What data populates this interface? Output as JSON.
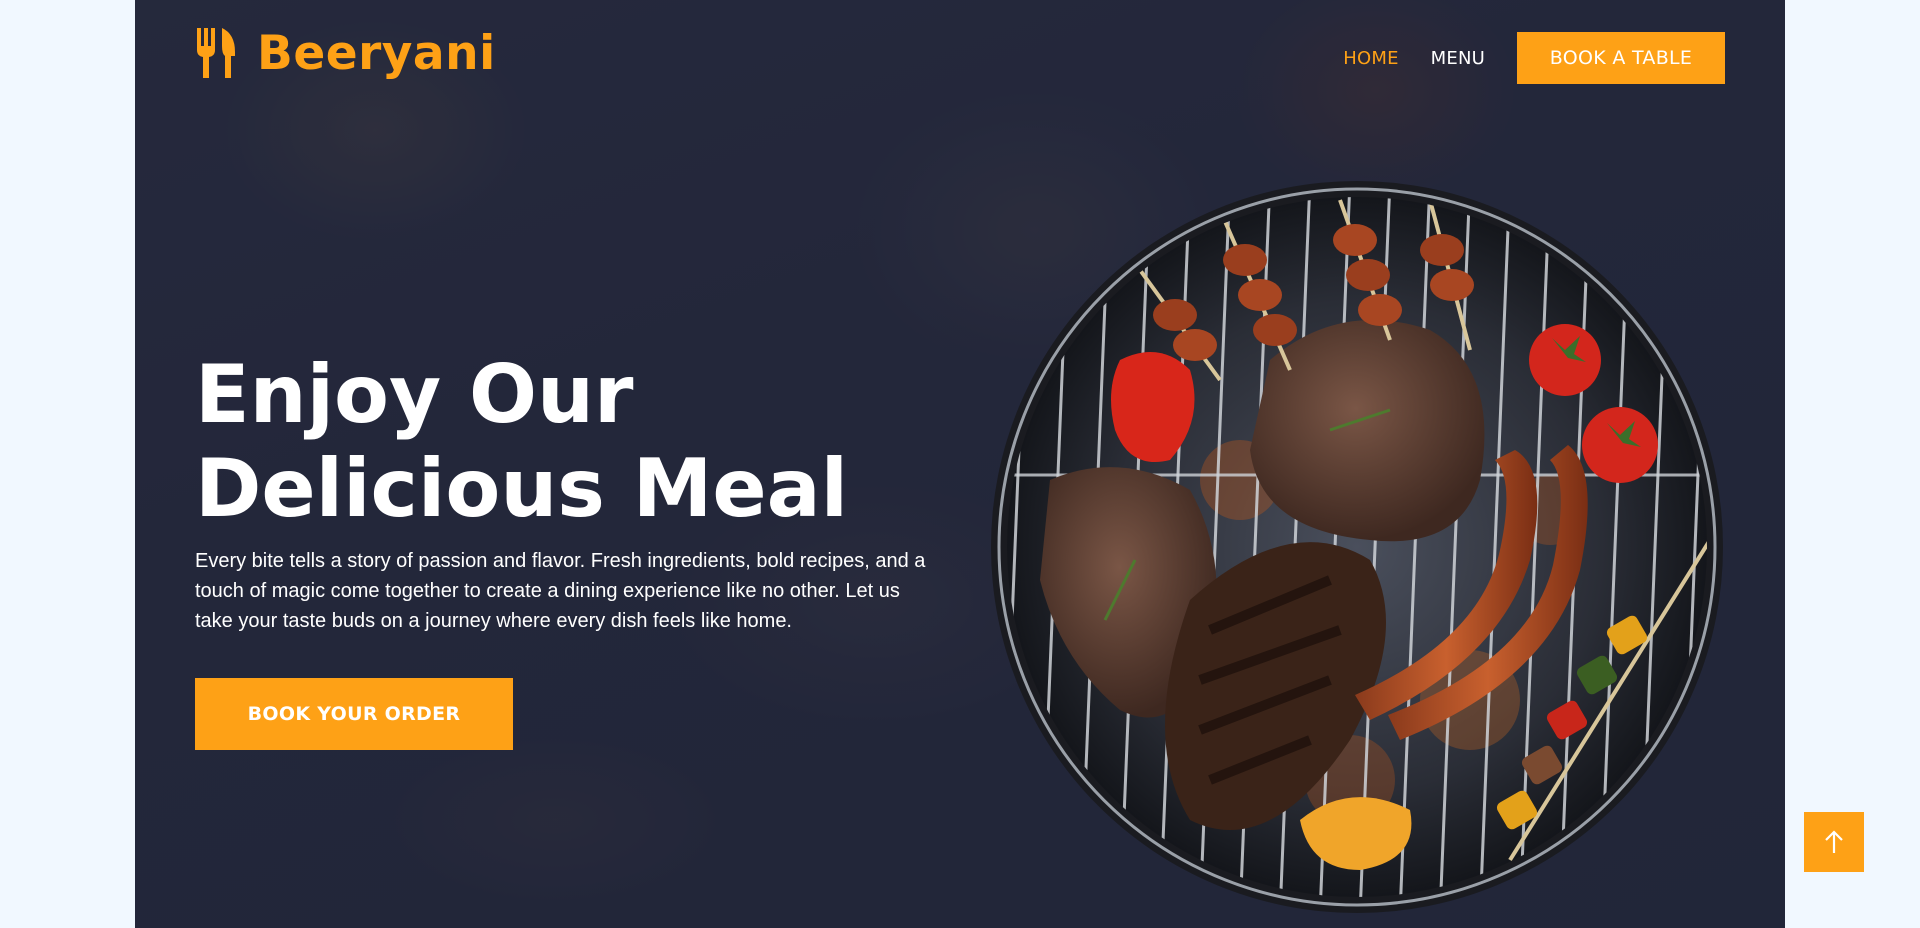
{
  "brand": {
    "name": "Beeryani",
    "icon": "utensils-icon",
    "color": "#fea116"
  },
  "nav": {
    "items": [
      {
        "label": "HOME",
        "active": true
      },
      {
        "label": "MENU",
        "active": false
      }
    ],
    "cta_label": "BOOK A TABLE"
  },
  "hero": {
    "title_line1": "Enjoy Our",
    "title_line2": "Delicious Meal",
    "description": "Every bite tells a story of passion and flavor. Fresh ingredients, bold recipes, and a touch of magic come together to create a dining experience like no other. Let us take your taste buds on a journey where every dish feels like home.",
    "button_label": "BOOK YOUR ORDER",
    "image": "grilled-meat-platter-image"
  },
  "back_to_top": {
    "icon": "arrow-up-icon"
  },
  "colors": {
    "accent": "#fea116",
    "page_bg": "#f1f8ff",
    "hero_bg": "#262a3c"
  }
}
